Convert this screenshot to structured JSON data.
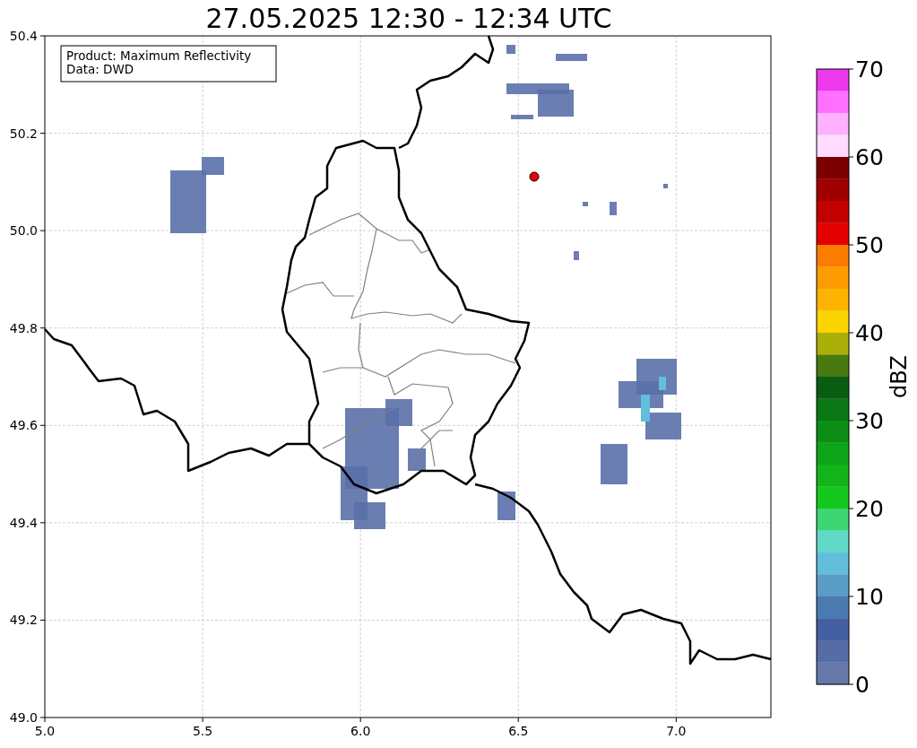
{
  "title": "27.05.2025 12:30 - 12:34 UTC",
  "info_box": {
    "lines": [
      "Product: Maximum Reflectivity",
      "Data: DWD"
    ]
  },
  "x_ticks": [
    "5.0",
    "5.5",
    "6.0",
    "6.5",
    "7.0"
  ],
  "y_ticks": [
    "50.4",
    "50.2",
    "50.0",
    "49.8",
    "49.6",
    "49.4",
    "49.2",
    "49.0"
  ],
  "colorbar": {
    "label": "dBZ",
    "ticks": [
      "70",
      "60",
      "50",
      "40",
      "30",
      "20",
      "10",
      "0"
    ],
    "segments": [
      {
        "color": "#ee38ee"
      },
      {
        "color": "#ff70ff"
      },
      {
        "color": "#ffb0ff"
      },
      {
        "color": "#ffdcff"
      },
      {
        "color": "#7c0000"
      },
      {
        "color": "#a00000"
      },
      {
        "color": "#c20000"
      },
      {
        "color": "#e40000"
      },
      {
        "color": "#fc7c00"
      },
      {
        "color": "#fc9c00"
      },
      {
        "color": "#fcb400"
      },
      {
        "color": "#fcd400"
      },
      {
        "color": "#aab008"
      },
      {
        "color": "#487a10"
      },
      {
        "color": "#0a5c12"
      },
      {
        "color": "#0a7614"
      },
      {
        "color": "#0c8e16"
      },
      {
        "color": "#0ea41a"
      },
      {
        "color": "#12b41a"
      },
      {
        "color": "#14c81e"
      },
      {
        "color": "#3ed672"
      },
      {
        "color": "#62d8c8"
      },
      {
        "color": "#62bedb"
      },
      {
        "color": "#5a9ec8"
      },
      {
        "color": "#4a7ab0"
      },
      {
        "color": "#4560a2"
      },
      {
        "color": "#566ca6"
      },
      {
        "color": "#6678a8"
      }
    ]
  }
}
